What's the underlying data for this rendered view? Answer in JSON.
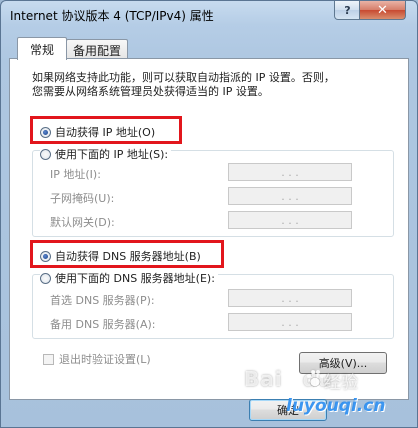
{
  "window": {
    "title": "Internet 协议版本 4 (TCP/IPv4) 属性"
  },
  "caption_buttons": {
    "help": "?",
    "close": "✕"
  },
  "tabs": [
    {
      "label": "常规",
      "active": true
    },
    {
      "label": "备用配置",
      "active": false
    }
  ],
  "description": {
    "line1": "如果网络支持此功能，则可以获取自动指派的 IP 设置。否则，",
    "line2": "您需要从网络系统管理员处获得适当的 IP 设置。"
  },
  "ip_section": {
    "auto_label": "自动获得 IP 地址(O)",
    "auto_selected": true,
    "manual_label": "使用下面的 IP 地址(S):",
    "fields": [
      {
        "label": "IP 地址(I):"
      },
      {
        "label": "子网掩码(U):"
      },
      {
        "label": "默认网关(D):"
      }
    ]
  },
  "dns_section": {
    "auto_label": "自动获得 DNS 服务器地址(B)",
    "auto_selected": true,
    "manual_label": "使用下面的 DNS 服务器地址(E):",
    "fields": [
      {
        "label": "首选 DNS 服务器(P):"
      },
      {
        "label": "备用 DNS 服务器(A):"
      }
    ]
  },
  "ip_placeholder_dots": ".   .   .",
  "validate_checkbox": {
    "label": "退出时验证设置(L)",
    "checked": false
  },
  "buttons": {
    "advanced": "高级(V)...",
    "ok": "确定"
  },
  "watermark": {
    "baidu": "Bai",
    "du": "du",
    "jingyan": "经验",
    "domain": "luyouqi.cn"
  },
  "colors": {
    "highlight": "#e2161c",
    "accent": "#3c7fb1"
  }
}
